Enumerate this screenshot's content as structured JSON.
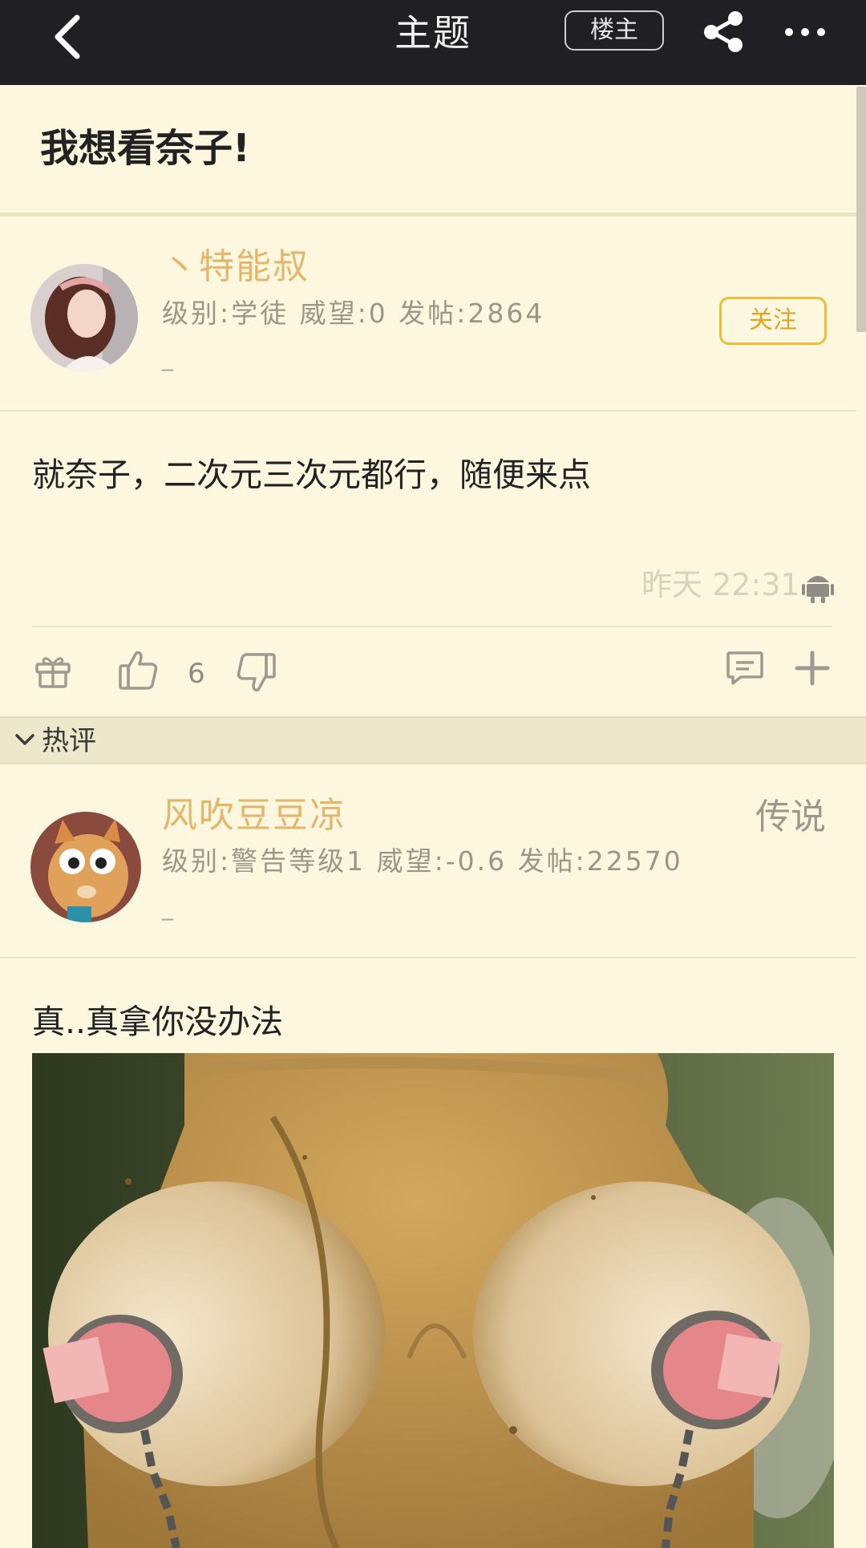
{
  "header": {
    "title": "主题",
    "op_button": "楼主",
    "back_icon": "chevron-left-icon",
    "share_icon": "share-icon",
    "more_icon": "more-dots-icon"
  },
  "thread": {
    "title": "我想看奈子!"
  },
  "main_post": {
    "username": "丶特能叔",
    "meta": "级别:学徒 威望:0 发帖:2864",
    "signature": "_",
    "follow_button": "关注",
    "body": "就奈子，二次元三次元都行，随便来点",
    "time": "昨天 22:31",
    "device_icon": "android-icon",
    "likes": "6",
    "actions": [
      "gift-icon",
      "thumbs-up-icon",
      "thumbs-down-icon",
      "comment-icon",
      "plus-icon"
    ]
  },
  "hot_section": {
    "label": "热评"
  },
  "reply": {
    "username": "风吹豆豆凉",
    "rank": "传说",
    "meta": "级别:警告等级1 威望:-0.6 发帖:22570",
    "signature": "_",
    "body": "真..真拿你没办法"
  },
  "colors": {
    "background": "#fdf7e0",
    "topbar": "#1f1f24",
    "username": "#e3b66a",
    "follow_border": "#e8be3c"
  }
}
